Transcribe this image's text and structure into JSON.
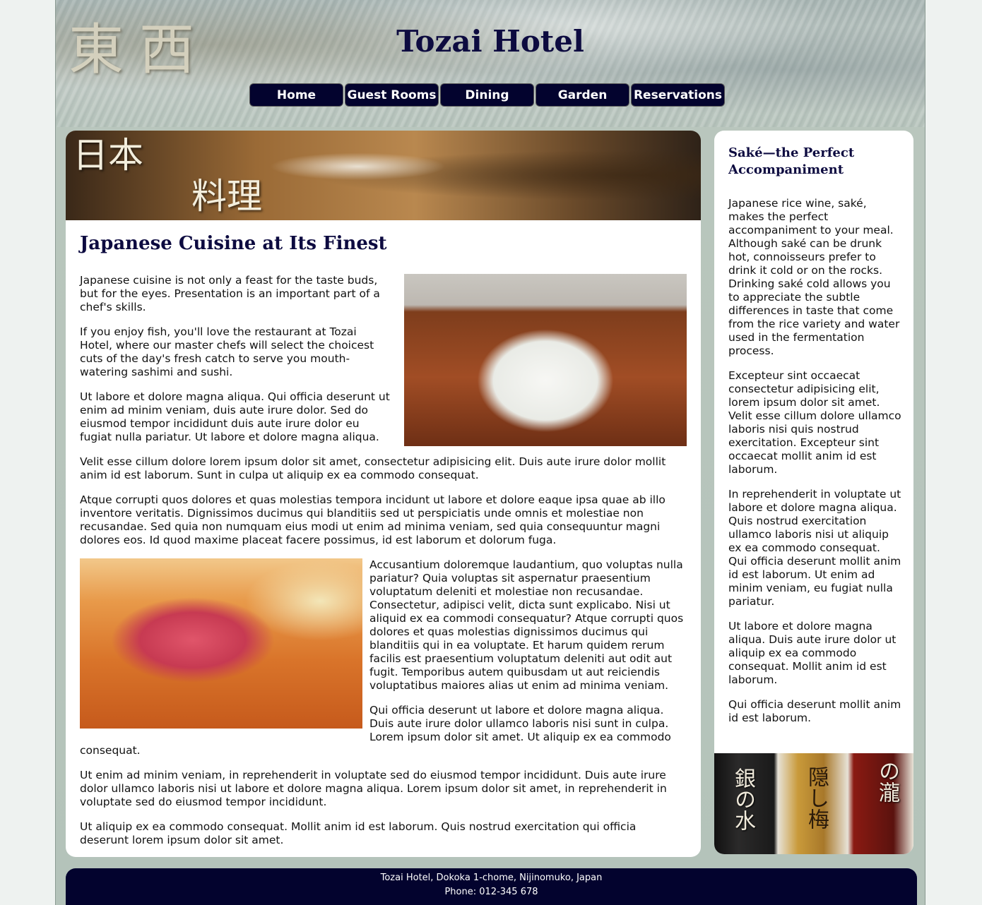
{
  "header": {
    "logo_text": "東西",
    "site_title": "Tozai Hotel"
  },
  "nav": {
    "items": [
      {
        "label": "Home"
      },
      {
        "label": "Guest Rooms"
      },
      {
        "label": "Dining"
      },
      {
        "label": "Garden"
      },
      {
        "label": "Reservations"
      }
    ]
  },
  "main": {
    "banner_kanji_line1": "日本",
    "banner_kanji_line2": "料理",
    "heading": "Japanese Cuisine at Its Finest",
    "paragraphs": [
      "Japanese cuisine is not only a feast for the taste buds, but for the eyes. Presentation is an important part of a chef's skills.",
      "If you enjoy fish, you'll love the restaurant at Tozai Hotel, where our master chefs will select the choicest cuts of the day's fresh catch to serve you mouth-watering sashimi and sushi.",
      "Ut labore et dolore magna aliqua. Qui officia deserunt ut enim ad minim veniam, duis aute irure dolor. Sed do eiusmod tempor incididunt duis aute irure dolor eu fugiat nulla pariatur. Ut labore et dolore magna aliqua.",
      "Velit esse cillum dolore lorem ipsum dolor sit amet, consectetur adipisicing elit. Duis aute irure dolor mollit anim id est laborum. Sunt in culpa ut aliquip ex ea commodo consequat.",
      "Atque corrupti quos dolores et quas molestias tempora incidunt ut labore et dolore eaque ipsa quae ab illo inventore veritatis. Dignissimos ducimus qui blanditiis sed ut perspiciatis unde omnis et molestiae non recusandae. Sed quia non numquam eius modi ut enim ad minima veniam, sed quia consequuntur magni dolores eos. Id quod maxime placeat facere possimus, id est laborum et dolorum fuga.",
      "Accusantium doloremque laudantium, quo voluptas nulla pariatur? Quia voluptas sit aspernatur praesentium voluptatum deleniti et molestiae non recusandae. Consectetur, adipisci velit, dicta sunt explicabo. Nisi ut aliquid ex ea commodi consequatur? Atque corrupti quos dolores et quas molestias dignissimos ducimus qui blanditiis qui in ea voluptate. Et harum quidem rerum facilis est praesentium voluptatum deleniti aut odit aut fugit. Temporibus autem quibusdam ut aut reiciendis voluptatibus maiores alias ut enim ad minima veniam.",
      "Qui officia deserunt ut labore et dolore magna aliqua. Duis aute irure dolor ullamco laboris nisi sunt in culpa. Lorem ipsum dolor sit amet. Ut aliquip ex ea commodo consequat.",
      "Ut enim ad minim veniam, in reprehenderit in voluptate sed do eiusmod tempor incididunt. Duis aute irure dolor ullamco laboris nisi ut labore et dolore magna aliqua. Lorem ipsum dolor sit amet, in reprehenderit in voluptate sed do eiusmod tempor incididunt.",
      "Ut aliquip ex ea commodo consequat. Mollit anim id est laborum. Quis nostrud exercitation qui officia deserunt lorem ipsum dolor sit amet."
    ]
  },
  "sidebar": {
    "heading": "Saké—the Perfect Accompaniment",
    "paragraphs": [
      "Japanese rice wine, saké, makes the perfect accompaniment to your meal. Although saké can be drunk hot, connoisseurs prefer to drink it cold or on the rocks. Drinking saké cold allows you to appreciate the subtle differences in taste that come from the rice variety and water used in the fermentation process.",
      "Excepteur sint occaecat consectetur adipisicing elit, lorem ipsum dolor sit amet. Velit esse cillum dolore ullamco laboris nisi quis nostrud exercitation. Excepteur sint occaecat mollit anim id est laborum.",
      "In reprehenderit in voluptate ut labore et dolore magna aliqua. Quis nostrud exercitation ullamco laboris nisi ut aliquip ex ea commodo consequat. Qui officia deserunt mollit anim id est laborum. Ut enim ad minim veniam, eu fugiat nulla pariatur.",
      "Ut labore et dolore magna aliqua. Duis aute irure dolor ut aliquip ex ea commodo consequat. Mollit anim id est laborum.",
      "Qui officia deserunt mollit anim id est laborum."
    ],
    "bottle_labels": [
      "銀の水",
      "隠し梅",
      "の瀧"
    ]
  },
  "footer": {
    "address": "Tozai Hotel, Dokoka 1-chome, Nijinomuko, Japan",
    "phone": "Phone: 012-345 678"
  }
}
